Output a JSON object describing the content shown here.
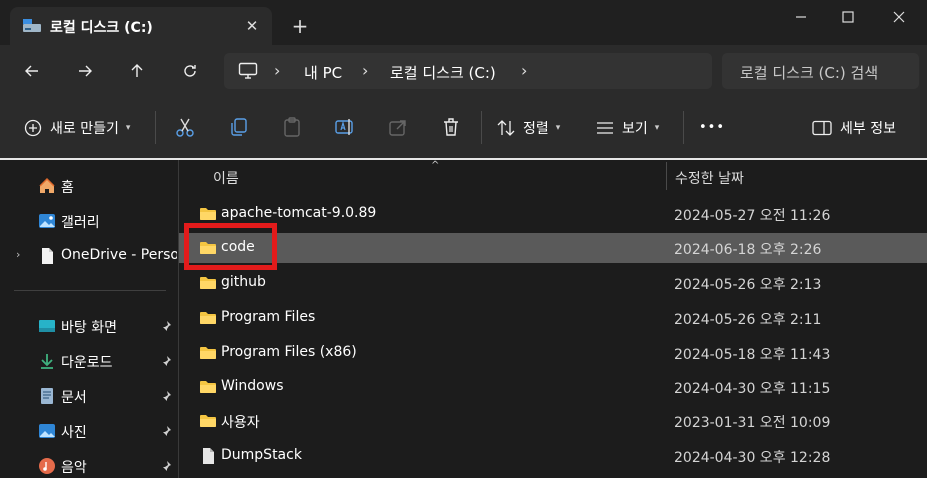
{
  "tab": {
    "title": "로컬 디스크 (C:)",
    "close_glyph": "✕",
    "new_tab_glyph": "+"
  },
  "window_controls": {
    "minimize": "—",
    "maximize": "☐",
    "close": "✕"
  },
  "breadcrumb": {
    "items": [
      "내 PC",
      "로컬 디스크 (C:)"
    ],
    "separator": "›"
  },
  "search": {
    "placeholder": "로컬 디스크 (C:) 검색"
  },
  "toolbar": {
    "new_label": "새로 만들기",
    "sort_label": "정렬",
    "view_label": "보기",
    "more_label": "•••",
    "details_label": "세부 정보"
  },
  "sidebar": {
    "items": [
      {
        "label": "홈",
        "icon": "home-icon"
      },
      {
        "label": "갤러리",
        "icon": "gallery-icon"
      },
      {
        "label": "OneDrive - Persona",
        "icon": "document-icon"
      }
    ],
    "pinned": [
      {
        "label": "바탕 화면",
        "icon": "desktop-icon"
      },
      {
        "label": "다운로드",
        "icon": "download-icon"
      },
      {
        "label": "문서",
        "icon": "documents-icon"
      },
      {
        "label": "사진",
        "icon": "pictures-icon"
      },
      {
        "label": "음악",
        "icon": "music-icon"
      }
    ]
  },
  "columns": {
    "name": "이름",
    "date": "수정한 날짜"
  },
  "files": [
    {
      "name": "apache-tomcat-9.0.89",
      "date": "2024-05-27 오전 11:26",
      "type": "folder"
    },
    {
      "name": "code",
      "date": "2024-06-18 오후 2:26",
      "type": "folder",
      "selected": true
    },
    {
      "name": "github",
      "date": "2024-05-26 오후 2:13",
      "type": "folder"
    },
    {
      "name": "Program Files",
      "date": "2024-05-26 오후 2:11",
      "type": "folder"
    },
    {
      "name": "Program Files (x86)",
      "date": "2024-05-18 오후 11:43",
      "type": "folder"
    },
    {
      "name": "Windows",
      "date": "2024-04-30 오후 11:15",
      "type": "folder"
    },
    {
      "name": "사용자",
      "date": "2023-01-31 오전 10:09",
      "type": "folder"
    },
    {
      "name": "DumpStack",
      "date": "2024-04-30 오후 12:28",
      "type": "file"
    }
  ],
  "colors": {
    "accent_highlight": "#e31b1b",
    "folder": "#f4c542",
    "selected_row": "#5a5a5a"
  }
}
